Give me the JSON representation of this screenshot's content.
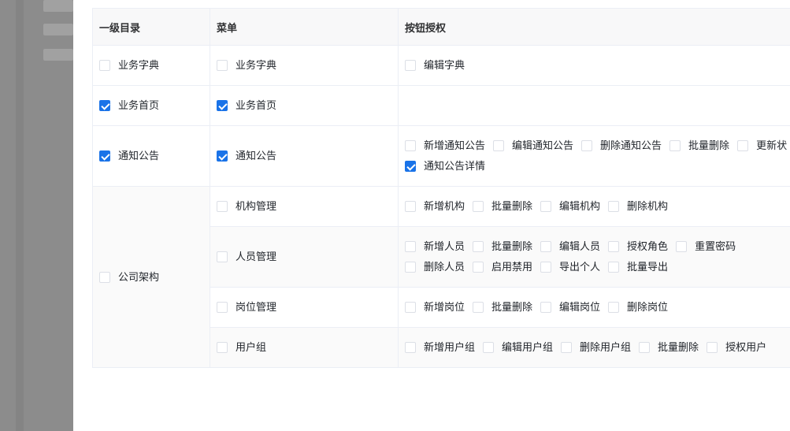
{
  "table": {
    "headers": [
      "一级目录",
      "菜单",
      "按钮授权"
    ],
    "groups": [
      {
        "label": "业务字典",
        "checked": false,
        "menus": [
          {
            "label": "业务字典",
            "checked": false,
            "buttons": [
              [
                {
                  "label": "编辑字典",
                  "checked": false
                }
              ]
            ]
          }
        ]
      },
      {
        "label": "业务首页",
        "checked": true,
        "menus": [
          {
            "label": "业务首页",
            "checked": true,
            "buttons": []
          }
        ]
      },
      {
        "label": "通知公告",
        "checked": true,
        "menus": [
          {
            "label": "通知公告",
            "checked": true,
            "buttons": [
              [
                {
                  "label": "新增通知公告",
                  "checked": false
                },
                {
                  "label": "编辑通知公告",
                  "checked": false
                },
                {
                  "label": "删除通知公告",
                  "checked": false
                },
                {
                  "label": "批量删除",
                  "checked": false
                },
                {
                  "label": "更新状",
                  "checked": false
                }
              ],
              [
                {
                  "label": "通知公告详情",
                  "checked": true
                }
              ]
            ]
          }
        ]
      },
      {
        "label": "公司架构",
        "checked": false,
        "menus": [
          {
            "label": "机构管理",
            "checked": false,
            "buttons": [
              [
                {
                  "label": "新增机构",
                  "checked": false
                },
                {
                  "label": "批量删除",
                  "checked": false
                },
                {
                  "label": "编辑机构",
                  "checked": false
                },
                {
                  "label": "删除机构",
                  "checked": false
                }
              ]
            ]
          },
          {
            "label": "人员管理",
            "checked": false,
            "buttons": [
              [
                {
                  "label": "新增人员",
                  "checked": false
                },
                {
                  "label": "批量删除",
                  "checked": false
                },
                {
                  "label": "编辑人员",
                  "checked": false
                },
                {
                  "label": "授权角色",
                  "checked": false
                },
                {
                  "label": "重置密码",
                  "checked": false
                }
              ],
              [
                {
                  "label": "删除人员",
                  "checked": false
                },
                {
                  "label": "启用禁用",
                  "checked": false
                },
                {
                  "label": "导出个人",
                  "checked": false
                },
                {
                  "label": "批量导出",
                  "checked": false
                }
              ]
            ]
          },
          {
            "label": "岗位管理",
            "checked": false,
            "buttons": [
              [
                {
                  "label": "新增岗位",
                  "checked": false
                },
                {
                  "label": "批量删除",
                  "checked": false
                },
                {
                  "label": "编辑岗位",
                  "checked": false
                },
                {
                  "label": "删除岗位",
                  "checked": false
                }
              ]
            ]
          },
          {
            "label": "用户组",
            "checked": false,
            "buttons": [
              [
                {
                  "label": "新增用户组",
                  "checked": false
                },
                {
                  "label": "编辑用户组",
                  "checked": false
                },
                {
                  "label": "删除用户组",
                  "checked": false
                },
                {
                  "label": "批量删除",
                  "checked": false
                },
                {
                  "label": "授权用户",
                  "checked": false
                }
              ]
            ]
          }
        ]
      }
    ]
  }
}
